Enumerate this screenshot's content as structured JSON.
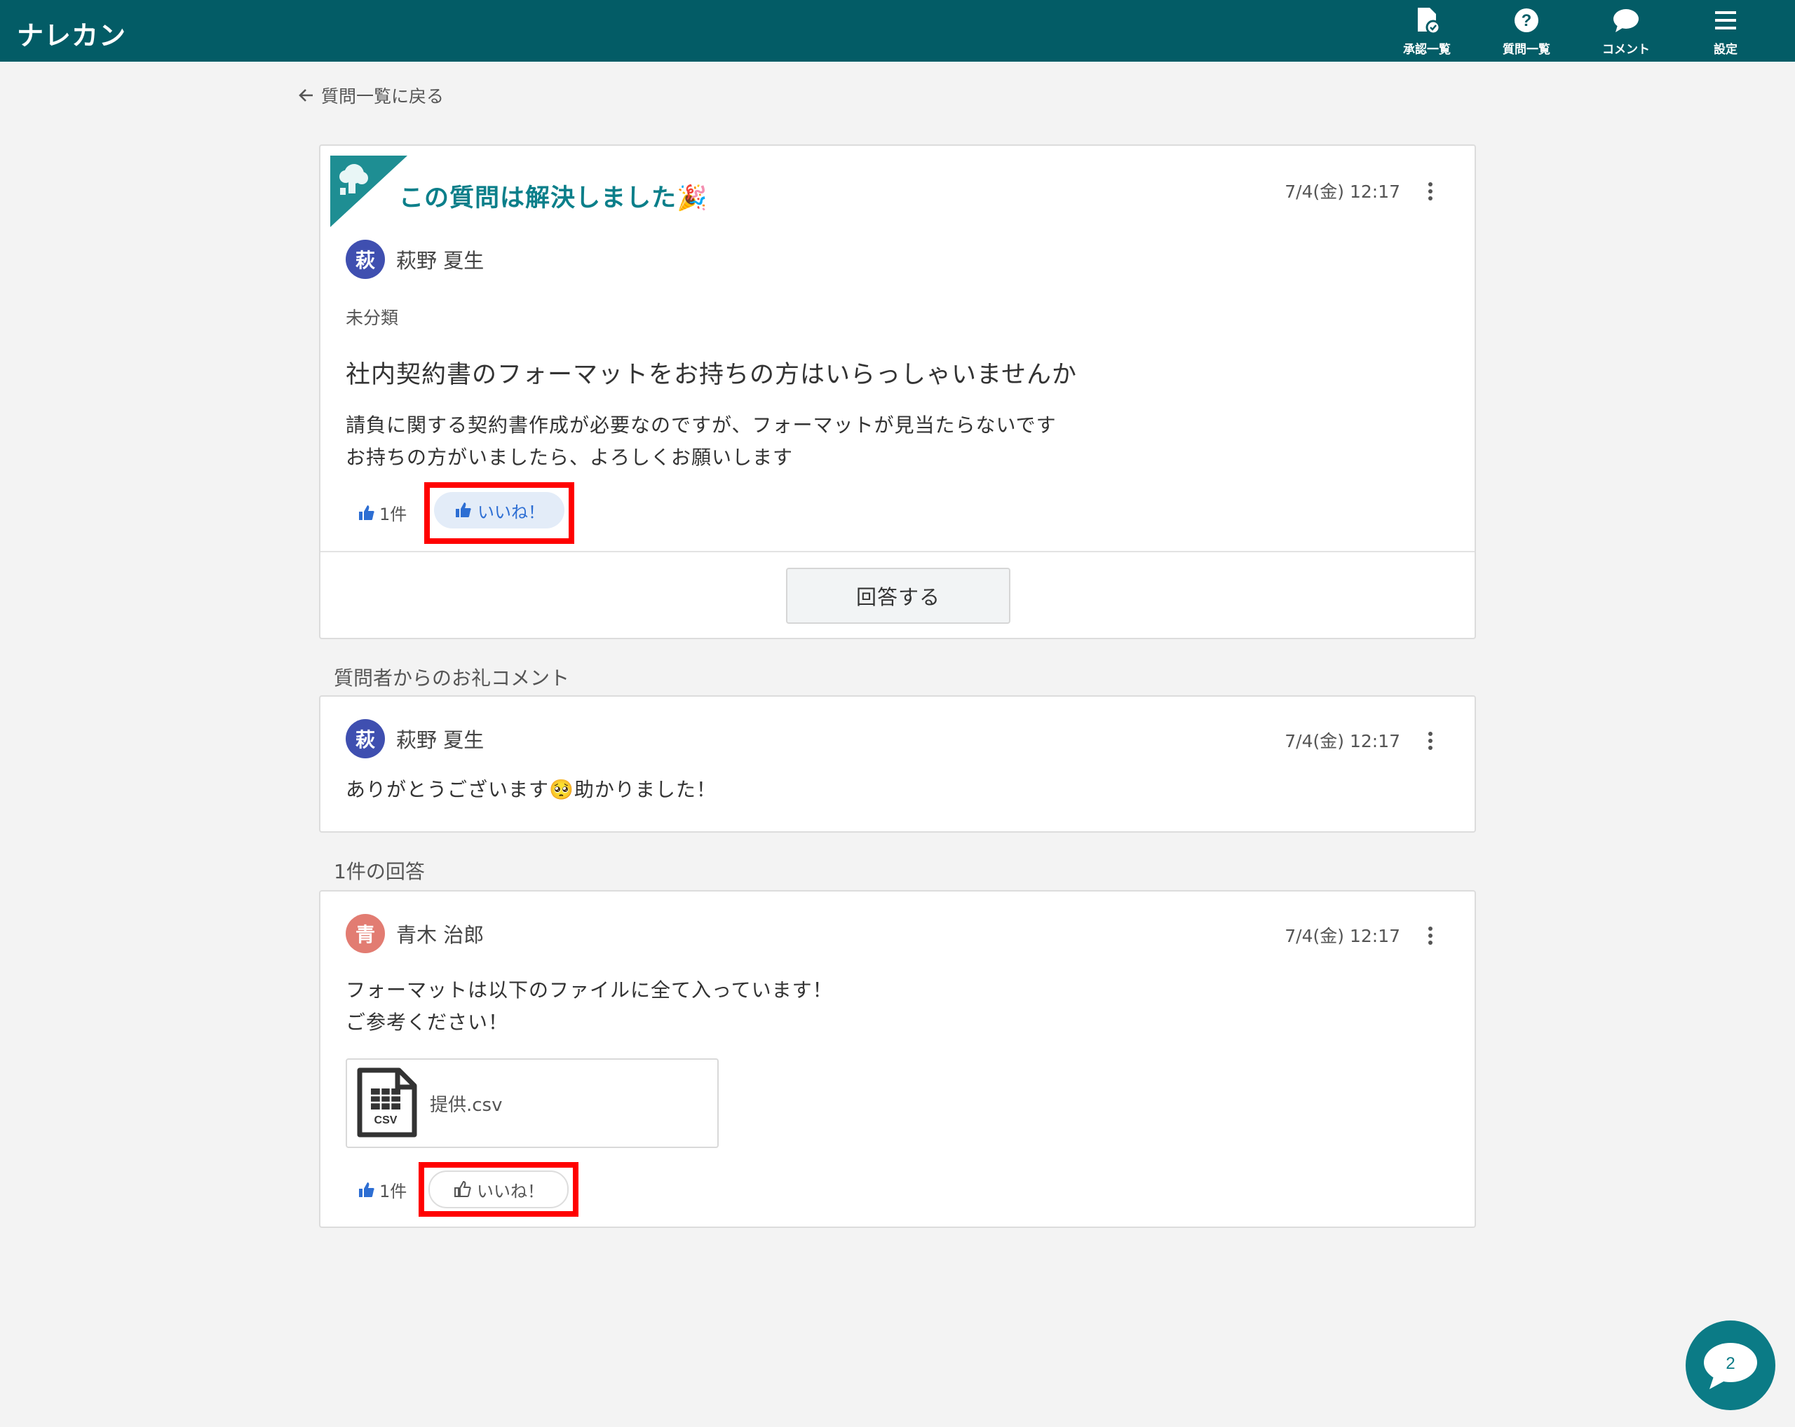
{
  "header": {
    "brand": "ナレカン",
    "nav": [
      {
        "label": "承認一覧",
        "icon": "document-check-icon"
      },
      {
        "label": "質問一覧",
        "icon": "question-circle-icon"
      },
      {
        "label": "コメント",
        "icon": "speech-bubble-icon"
      },
      {
        "label": "設定",
        "icon": "hamburger-menu-icon"
      }
    ]
  },
  "back_link": "質問一覧に戻る",
  "question": {
    "solved_title": "この質問は解決しました🎉",
    "timestamp": "7/4(金) 12:17",
    "author": {
      "initial": "萩",
      "name": "萩野 夏生",
      "color": "#3f4fb0"
    },
    "category": "未分類",
    "title": "社内契約書のフォーマットをお持ちの方はいらっしゃいませんか",
    "body_lines": [
      "請負に関する契約書作成が必要なのですが、フォーマットが見当たらないです",
      "お持ちの方がいましたら、よろしくお願いします"
    ],
    "like_count": "1件",
    "like_button": "いいね！",
    "answer_button": "回答する"
  },
  "thanks_section": {
    "label": "質問者からのお礼コメント",
    "comment": {
      "timestamp": "7/4(金) 12:17",
      "author": {
        "initial": "萩",
        "name": "萩野 夏生",
        "color": "#3f4fb0"
      },
      "text": "ありがとうございます🥺助かりました！"
    }
  },
  "answers_section": {
    "label": "1件の回答",
    "answer": {
      "timestamp": "7/4(金) 12:17",
      "author": {
        "initial": "青",
        "name": "青木 治郎",
        "color": "#e27c72"
      },
      "body_lines": [
        "フォーマットは以下のファイルに全て入っています！",
        "ご参考ください！"
      ],
      "attachment": {
        "name": "提供.csv",
        "type_label": "CSV"
      },
      "like_count": "1件",
      "like_button": "いいね！"
    }
  },
  "chat_fab": {
    "count": "2"
  }
}
